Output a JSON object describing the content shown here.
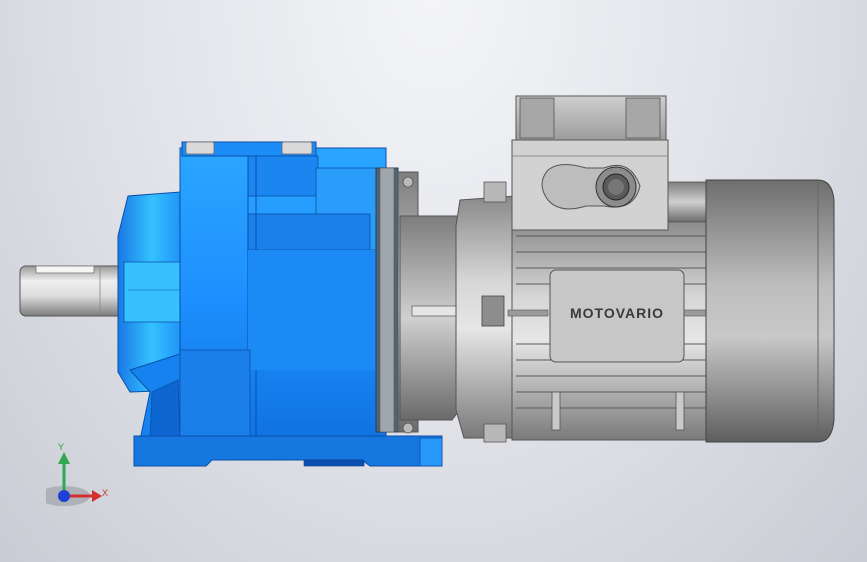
{
  "viewport": {
    "background_top": "#f4f5f8",
    "background_bottom": "#c9ccd4"
  },
  "model": {
    "nameplate_text": "MOTOVARIO",
    "colors": {
      "gearbox_blue": "#1e90ff",
      "gearbox_light": "#35b8ff",
      "gearbox_dark": "#0a5fcc",
      "motor_grey": "#b9b9b9",
      "motor_dark": "#6a6a6a",
      "shaft": "#d8d8d8"
    }
  },
  "triad": {
    "x_label": "X",
    "y_label": "Y",
    "x_color": "#d32f2f",
    "y_color": "#2fa84f",
    "z_color": "#1f3fd6"
  }
}
